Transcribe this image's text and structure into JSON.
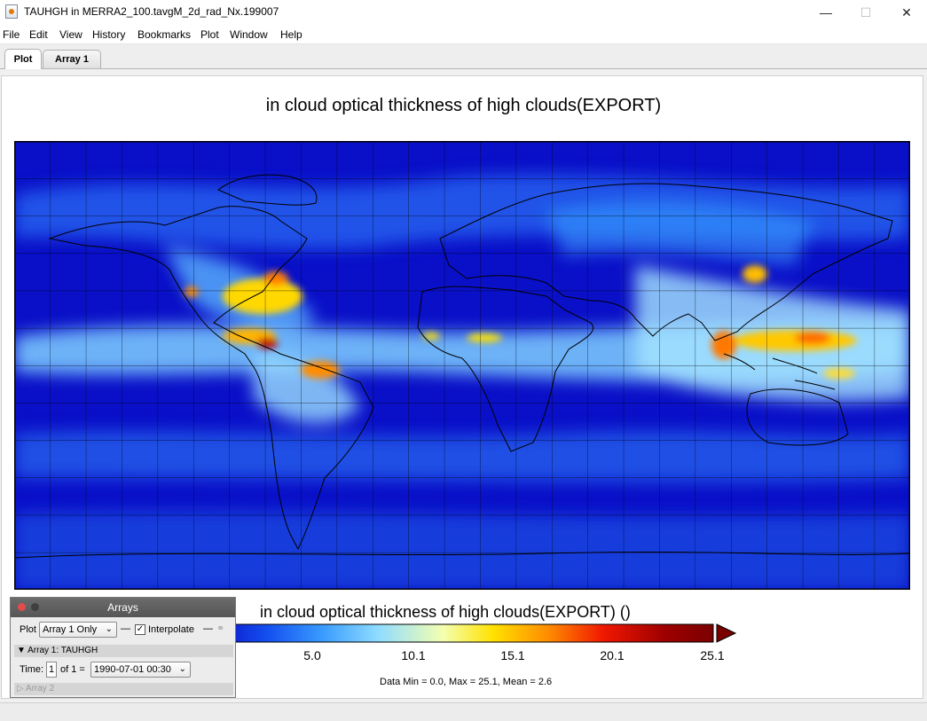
{
  "window": {
    "title": "TAUHGH in MERRA2_100.tavgM_2d_rad_Nx.199007",
    "minimize": "—",
    "maximize": "☐",
    "close": "✕"
  },
  "menu": [
    "File",
    "Edit",
    "View",
    "History",
    "Bookmarks",
    "Plot",
    "Window",
    "Help"
  ],
  "tabs": [
    {
      "label": "Plot",
      "active": true
    },
    {
      "label": "Array 1",
      "active": false
    }
  ],
  "plot": {
    "title": "in cloud optical thickness of high clouds(EXPORT)",
    "colorbar_title": "in cloud optical thickness of high clouds(EXPORT) ()",
    "colorbar_ticks": [
      "5.0",
      "10.1",
      "15.1",
      "20.1",
      "25.1"
    ],
    "stats": "Data Min = 0.0, Max = 25.1, Mean = 2.6",
    "colormap": [
      "#0a10c8",
      "#1450f0",
      "#3a9cff",
      "#8fdcff",
      "#f4ffb0",
      "#ffe100",
      "#ff8c00",
      "#f01800",
      "#a00000",
      "#7a0000"
    ]
  },
  "arrays_palette": {
    "title": "Arrays",
    "plot_label": "Plot",
    "plot_mode": "Array 1 Only",
    "dash1": "—",
    "interpolate_label": "Interpolate",
    "interpolate_checked": "✓",
    "dash2": "—",
    "array1_header": "▼ Array 1: TAUHGH",
    "time_label": "Time:",
    "time_index": "1",
    "time_of": "of 1 =",
    "time_value": "1990-07-01 00:30",
    "array2_header": "▷ Array 2"
  }
}
